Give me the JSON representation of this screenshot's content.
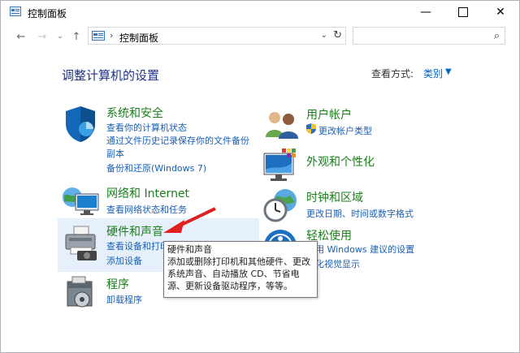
{
  "window": {
    "title": "控制面板"
  },
  "address": {
    "path": "控制面板"
  },
  "search": {
    "placeholder": ""
  },
  "header": {
    "heading": "调整计算机的设置",
    "view_by_label": "查看方式:",
    "view_by_value": "类别"
  },
  "categories": [
    {
      "id": "system",
      "title": "系统和安全",
      "icon": "shield-icon",
      "links": [
        "查看你的计算机状态",
        "通过文件历史记录保存你的文件备份",
        "副本",
        "备份和还原(Windows 7)"
      ]
    },
    {
      "id": "network",
      "title": "网络和 Internet",
      "icon": "network-globe-icon",
      "links": [
        "查看网络状态和任务"
      ]
    },
    {
      "id": "hardware",
      "title": "硬件和声音",
      "icon": "printer-icon",
      "links": [
        "查看设备和打印机",
        "添加设备"
      ]
    },
    {
      "id": "programs",
      "title": "程序",
      "icon": "programs-disk-icon",
      "links": [
        "卸载程序"
      ]
    },
    {
      "id": "users",
      "title": "用户帐户",
      "icon": "users-icon",
      "links": [
        "更改帐户类型"
      ]
    },
    {
      "id": "appearance",
      "title": "外观和个性化",
      "icon": "monitor-palette-icon",
      "links": []
    },
    {
      "id": "clock",
      "title": "时钟和区域",
      "icon": "clock-globe-icon",
      "links": [
        "更改日期、时间或数字格式"
      ]
    },
    {
      "id": "ease",
      "title": "轻松使用",
      "icon": "ease-of-access-icon",
      "links": [
        "使用 Windows 建议的设置",
        "优化视觉显示"
      ]
    }
  ],
  "tooltip": {
    "title": "硬件和声音",
    "desc": "添加或删除打印机和其他硬件、更改系统声音、自动播放 CD、节省电源、更新设备驱动程序，等等。"
  },
  "colors": {
    "heading": "#1e3287",
    "category_title": "#1a7f1a",
    "link": "#1a5fb4",
    "arrow": "#e02020"
  }
}
